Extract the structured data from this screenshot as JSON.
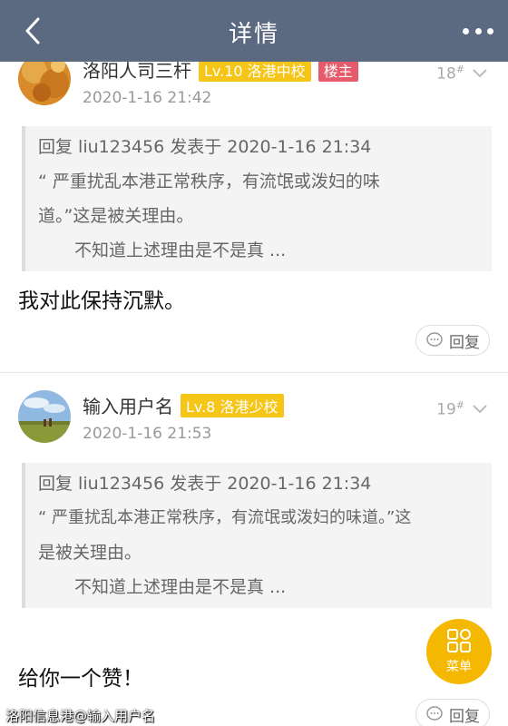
{
  "header": {
    "title": "详情",
    "back_icon": "chevron-left-icon",
    "more_icon": "more-dots-icon"
  },
  "colors": {
    "header_bg": "#5b6a80",
    "level_badge": "#f5c518",
    "owner_badge": "#e65b6b",
    "fab": "#f5b800"
  },
  "posts": [
    {
      "username": "洛阳人司三杆",
      "level": "Lv.10 洛港中校",
      "owner_badge": "楼主",
      "time": "2020-1-16 21:42",
      "floor": "18",
      "floor_sup": "#",
      "quote": {
        "head": "回复 liu123456 发表于 2020-1-16 21:34",
        "body_line1": "“    严重扰乱本港正常秩序，有流氓或泼妇的味",
        "body_line2": "道。”这是被关理由。",
        "more": "不知道上述理由是不是真 ..."
      },
      "text": "我对此保持沉默。",
      "reply_label": "回复"
    },
    {
      "username": "输入用户名",
      "level": "Lv.8 洛港少校",
      "time": "2020-1-16 21:53",
      "floor": "19",
      "floor_sup": "#",
      "quote": {
        "head": "回复 liu123456 发表于 2020-1-16 21:34",
        "body_line1": "“    严重扰乱本港正常秩序，有流氓或泼妇的味道。”这",
        "body_line2": "是被关理由。",
        "more": "不知道上述理由是不是真 ..."
      },
      "text": "给你一个赞！",
      "reply_label": "回复"
    }
  ],
  "fab": {
    "label": "菜单",
    "icon": "grid-menu-icon"
  },
  "watermark": "洛阳信息港@输入用户名"
}
